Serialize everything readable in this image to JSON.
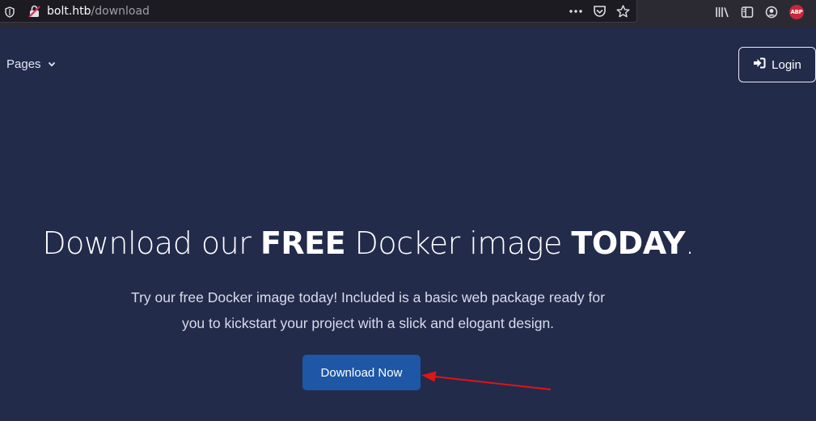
{
  "browser": {
    "url_host": "bolt.htb",
    "url_path": "/download",
    "icons": [
      "shield-icon",
      "lock-icon",
      "more-icon",
      "pocket-icon",
      "star-icon",
      "library-icon",
      "sidebar-icon",
      "account-icon",
      "adblock-icon"
    ],
    "adblock_label": "ABP"
  },
  "nav": {
    "pages_label": "Pages",
    "login_label": "Login"
  },
  "hero": {
    "title_1": "Download our ",
    "title_2": "FREE",
    "title_3": " Docker image ",
    "title_4": "TODAY",
    "title_5": ".",
    "line_1": "Try our free Docker image today! Included is a basic web package ready for",
    "line_2": "you to kickstart your project with a slick and elogant design.",
    "button_label": "Download Now"
  },
  "colors": {
    "background": "#232b4b",
    "button": "#1d57a6",
    "annotation": "#e01515"
  }
}
